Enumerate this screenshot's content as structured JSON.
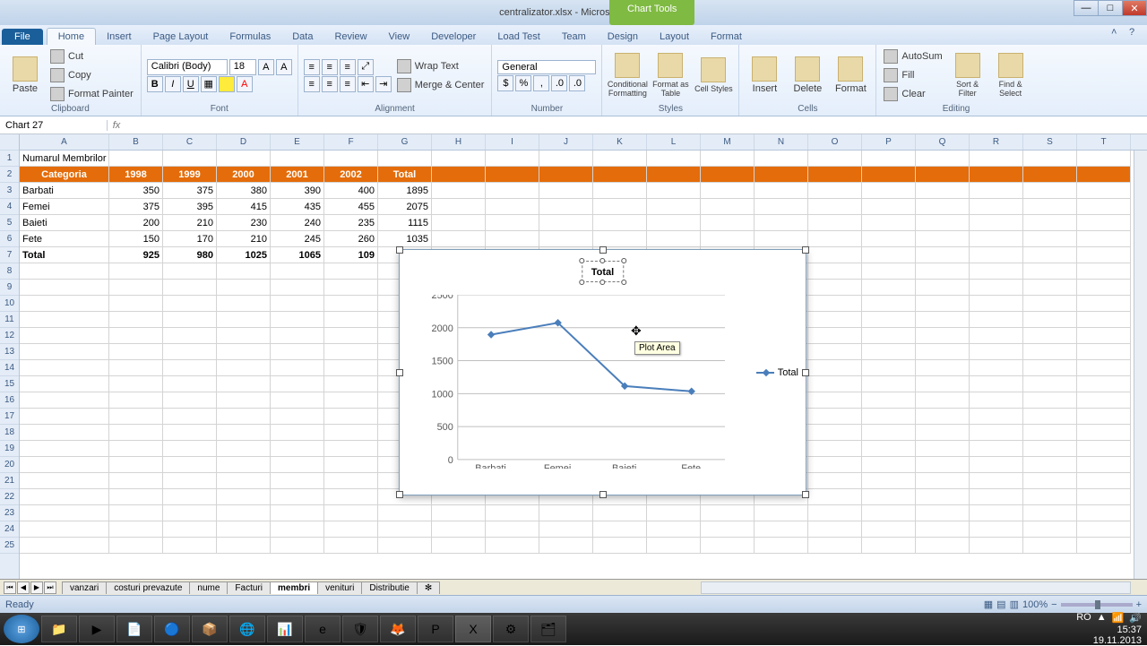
{
  "app": {
    "title": "centralizator.xlsx - Microsoft Excel",
    "chart_tools_label": "Chart Tools"
  },
  "tabs": {
    "file": "File",
    "list": [
      "Home",
      "Insert",
      "Page Layout",
      "Formulas",
      "Data",
      "Review",
      "View",
      "Developer",
      "Load Test",
      "Team",
      "Design",
      "Layout",
      "Format"
    ],
    "active": "Home"
  },
  "ribbon": {
    "clipboard": {
      "label": "Clipboard",
      "paste": "Paste",
      "cut": "Cut",
      "copy": "Copy",
      "fp": "Format Painter"
    },
    "font": {
      "label": "Font",
      "name": "Calibri (Body)",
      "size": "18"
    },
    "alignment": {
      "label": "Alignment",
      "wrap": "Wrap Text",
      "merge": "Merge & Center"
    },
    "number": {
      "label": "Number",
      "format": "General"
    },
    "styles": {
      "label": "Styles",
      "cond": "Conditional Formatting",
      "table": "Format as Table",
      "cell": "Cell Styles"
    },
    "cells": {
      "label": "Cells",
      "insert": "Insert",
      "delete": "Delete",
      "format": "Format"
    },
    "editing": {
      "label": "Editing",
      "sum": "AutoSum",
      "fill": "Fill",
      "clear": "Clear",
      "sort": "Sort & Filter",
      "find": "Find & Select"
    }
  },
  "namebox": "Chart 27",
  "sheet": {
    "cols": [
      "A",
      "B",
      "C",
      "D",
      "E",
      "F",
      "G",
      "H",
      "I",
      "J",
      "K",
      "L",
      "M",
      "N",
      "O",
      "P",
      "Q",
      "R",
      "S",
      "T"
    ],
    "title_cell": "Numarul Membrilor",
    "headers": [
      "Categoria",
      "1998",
      "1999",
      "2000",
      "2001",
      "2002",
      "Total"
    ],
    "rows": [
      {
        "cat": "Barbati",
        "vals": [
          "350",
          "375",
          "380",
          "390",
          "400",
          "1895"
        ]
      },
      {
        "cat": "Femei",
        "vals": [
          "375",
          "395",
          "415",
          "435",
          "455",
          "2075"
        ]
      },
      {
        "cat": "Baieti",
        "vals": [
          "200",
          "210",
          "230",
          "240",
          "235",
          "1115"
        ]
      },
      {
        "cat": "Fete",
        "vals": [
          "150",
          "170",
          "210",
          "245",
          "260",
          "1035"
        ]
      }
    ],
    "total_row": {
      "cat": "Total",
      "vals": [
        "925",
        "980",
        "1025",
        "1065",
        "109",
        "",
        ""
      ]
    }
  },
  "chart_data": {
    "type": "line",
    "title": "Total",
    "categories": [
      "Barbati",
      "Femei",
      "Baieti",
      "Fete"
    ],
    "series": [
      {
        "name": "Total",
        "values": [
          1895,
          2075,
          1115,
          1035
        ]
      }
    ],
    "ylabel": "",
    "xlabel": "",
    "ylim": [
      0,
      2500
    ],
    "yticks": [
      0,
      500,
      1000,
      1500,
      2000,
      2500
    ],
    "tooltip": "Plot Area",
    "legend_position": "right"
  },
  "sheet_tabs": [
    "vanzari",
    "costuri prevazute",
    "nume",
    "Facturi",
    "membri",
    "venituri",
    "Distributie"
  ],
  "sheet_active": "membri",
  "status": {
    "ready": "Ready",
    "zoom": "100%",
    "time": "15:37",
    "date": "19.11.2013",
    "lang": "RO"
  }
}
